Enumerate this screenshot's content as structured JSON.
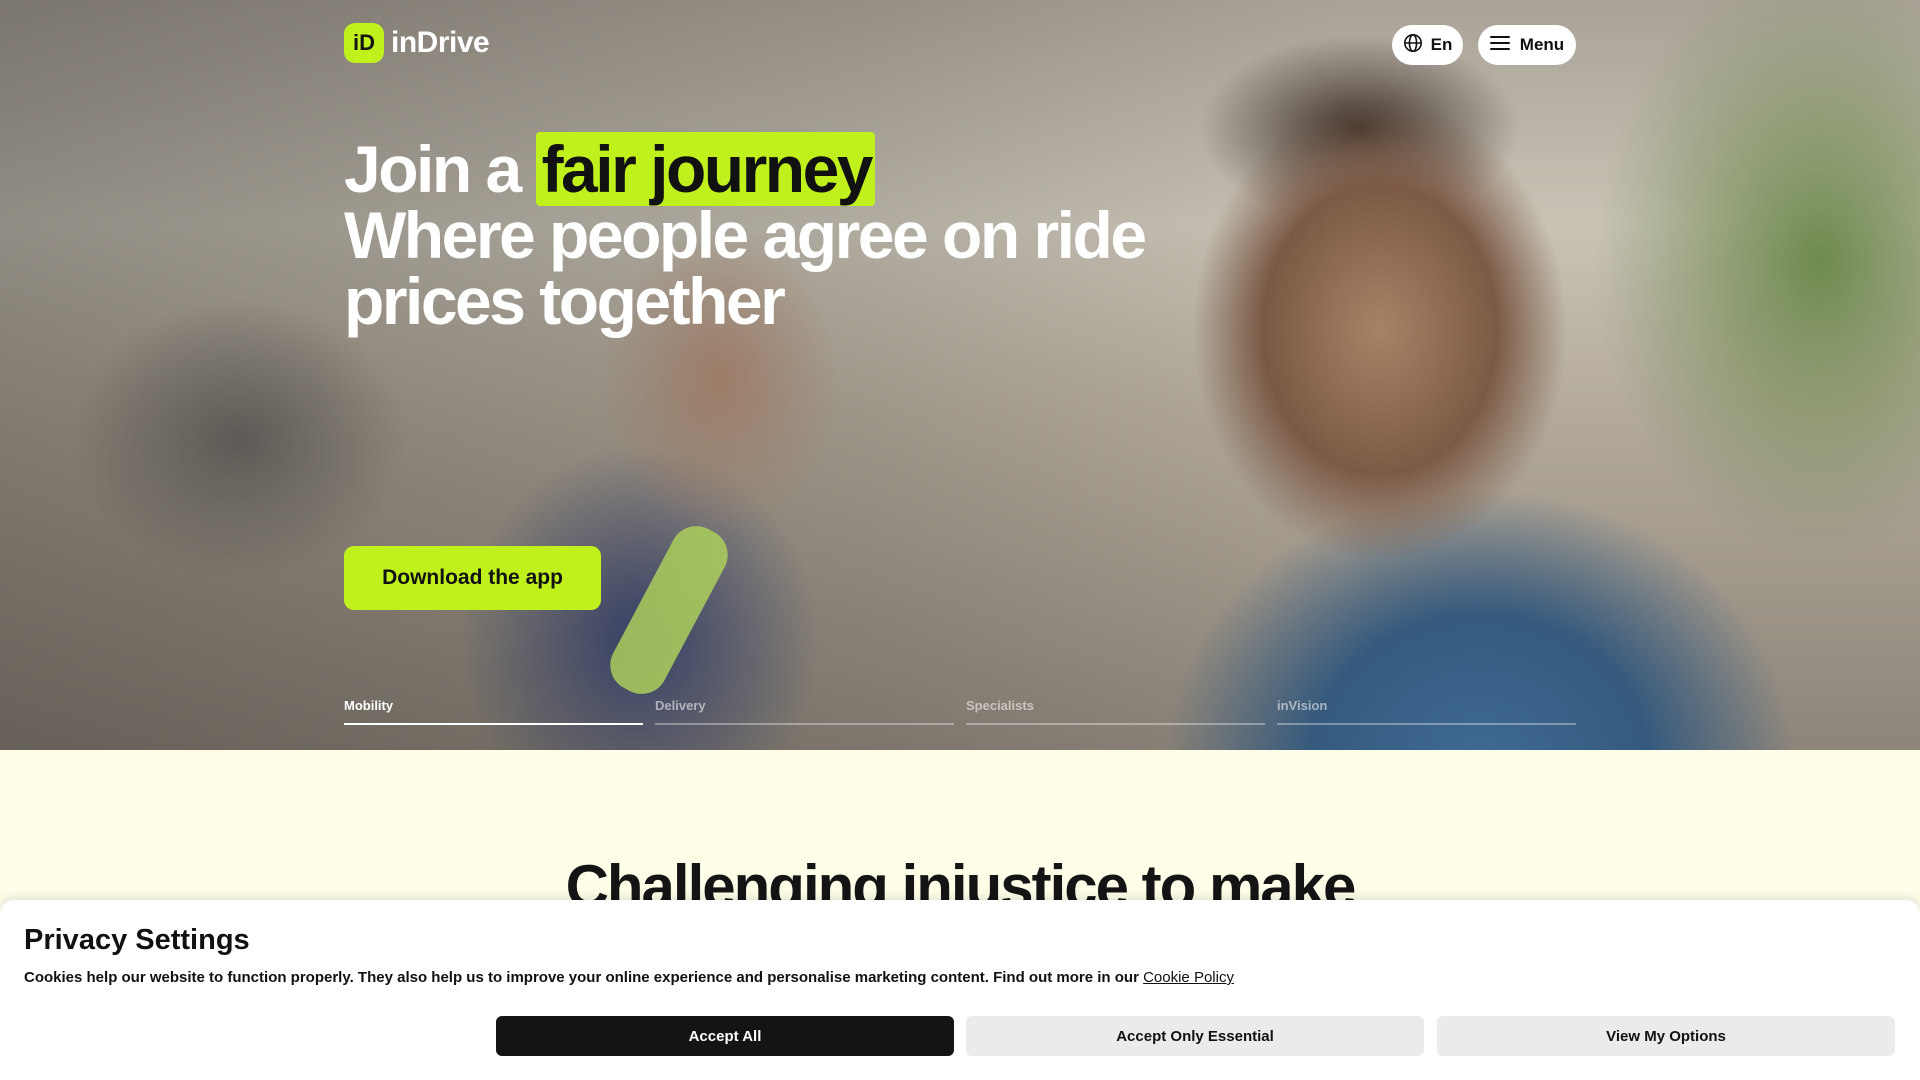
{
  "brand": {
    "logo_mark": "iD",
    "name": "inDrive",
    "accent_color": "#c1f11d"
  },
  "header": {
    "language_label": "En",
    "menu_label": "Menu",
    "language_icon": "globe-icon",
    "menu_icon": "hamburger-icon"
  },
  "hero": {
    "line1_prefix": "Join a",
    "line1_highlight": "fair journey",
    "line2": "Where people agree on ride",
    "line3": "prices together",
    "cta_label": "Download the app",
    "tabs": [
      {
        "label": "Mobility",
        "active": true
      },
      {
        "label": "Delivery",
        "active": false
      },
      {
        "label": "Specialists",
        "active": false
      },
      {
        "label": "inVision",
        "active": false
      }
    ]
  },
  "section": {
    "title": "Challenging injustice to make"
  },
  "privacy": {
    "title": "Privacy Settings",
    "text": "Cookies help our website to function properly. They also help us to improve your online experience and personalise marketing content. Find out more in our",
    "link_label": "Cookie Policy",
    "accept_all_label": "Accept All",
    "accept_essential_label": "Accept Only Essential",
    "view_options_label": "View My Options"
  }
}
